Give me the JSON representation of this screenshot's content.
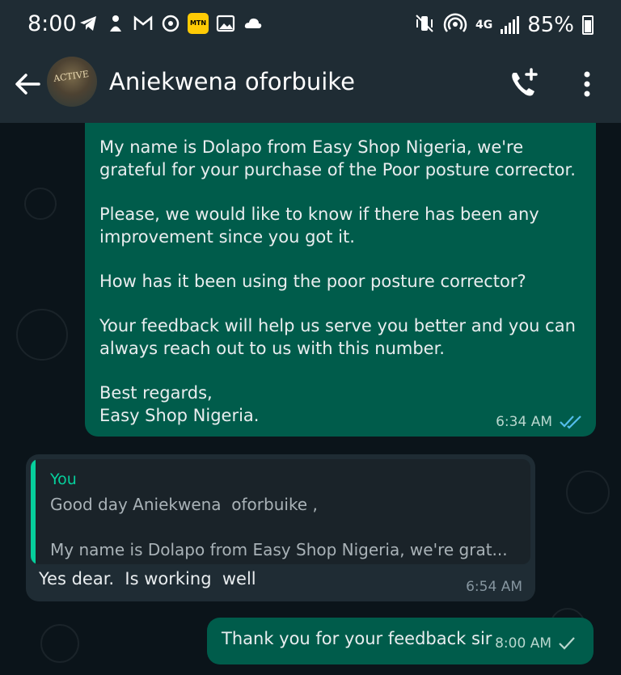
{
  "status_bar": {
    "time": "8:00",
    "network": "4G",
    "battery": "85%"
  },
  "header": {
    "contact_name": "Aniekwena oforbuike",
    "avatar_text": "ACTIVE"
  },
  "messages": {
    "out1": {
      "paragraphs": [
        "My name is Dolapo from Easy Shop Nigeria, we're grateful for your purchase of the Poor posture corrector.",
        "Please, we would like to know if there has been any improvement since you got it.",
        "How has it been using the poor posture corrector?",
        "Your feedback will help us serve you better and you can always reach out to us with this number.",
        "Best regards,\nEasy Shop Nigeria."
      ],
      "time": "6:34 AM",
      "status": "read"
    },
    "in1": {
      "quote_author": "You",
      "quote_line1": "Good day Aniekwena  oforbuike ,",
      "quote_line2": "My name is Dolapo from Easy Shop Nigeria, we're grat...",
      "text": "Yes dear.  Is working  well",
      "time": "6:54 AM"
    },
    "out2": {
      "text": "Thank you for your feedback sir",
      "time": "8:00 AM",
      "status": "sent"
    }
  },
  "colors": {
    "outgoing_bubble": "#005c4b",
    "incoming_bubble": "#1f2c34",
    "header_bg": "#1f2c34",
    "chat_bg": "#0b141a",
    "read_tick": "#53bdeb",
    "quote_accent": "#06cf9c"
  }
}
